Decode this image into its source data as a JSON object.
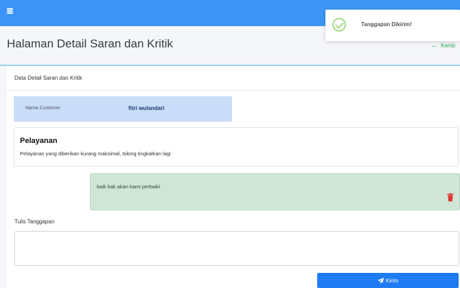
{
  "topbar": {
    "menu_icon": "hamburger-icon",
    "color": "#3c95f5"
  },
  "toast": {
    "message": "Tanggapan Dikirim!",
    "icon": "check-circle-icon",
    "color": "#a5dc86"
  },
  "header": {
    "title": "Halaman Detail Saran dan Kritik",
    "back_label": "Kemb",
    "back_icon": "arrow-left-icon"
  },
  "card": {
    "title": "Data Detail Saran dan Kritik"
  },
  "customer": {
    "label": "Nama Customer",
    "value": "fitri wulandari"
  },
  "feedback": {
    "category": "Pelayanan",
    "message": "Pelayanan yang diberikan kurang maksimal, tolong tingkatkan lagi"
  },
  "reply": {
    "text": "baik kak akan kami perbaiki",
    "delete_icon": "trash-icon"
  },
  "form": {
    "label": "Tulis Tanggapan",
    "value": "",
    "submit_label": "Kirim",
    "submit_icon": "paper-plane-icon"
  }
}
